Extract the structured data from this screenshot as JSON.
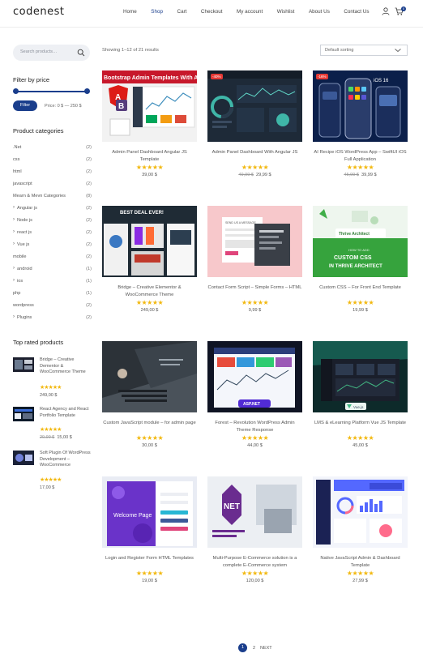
{
  "header": {
    "logo": "codenest",
    "nav": [
      "Home",
      "Shop",
      "Cart",
      "Checkout",
      "My account",
      "Wishlist",
      "About Us",
      "Contact Us"
    ],
    "active_nav": "Shop",
    "cart_count": "0"
  },
  "sidebar": {
    "search_placeholder": "Search products…",
    "filter_title": "Filter by price",
    "filter_button": "Filter",
    "price_text": "Price: 0 $ — 250 $",
    "categories_title": "Product categories",
    "categories": [
      {
        "name": ".Net",
        "count": "(2)",
        "sub": false
      },
      {
        "name": "css",
        "count": "(2)",
        "sub": false
      },
      {
        "name": "html",
        "count": "(2)",
        "sub": false
      },
      {
        "name": "javascript",
        "count": "(2)",
        "sub": false
      },
      {
        "name": "Mearn & Mevn Categories",
        "count": "(8)",
        "sub": false
      },
      {
        "name": "Angular js",
        "count": "(2)",
        "sub": true
      },
      {
        "name": "Node js",
        "count": "(2)",
        "sub": true
      },
      {
        "name": "react js",
        "count": "(2)",
        "sub": true
      },
      {
        "name": "Vue js",
        "count": "(2)",
        "sub": true
      },
      {
        "name": "mobile",
        "count": "(2)",
        "sub": false
      },
      {
        "name": "android",
        "count": "(1)",
        "sub": true
      },
      {
        "name": "ios",
        "count": "(1)",
        "sub": true
      },
      {
        "name": "php",
        "count": "(1)",
        "sub": false
      },
      {
        "name": "wordpress",
        "count": "(2)",
        "sub": false
      },
      {
        "name": "Plugins",
        "count": "(2)",
        "sub": true
      }
    ],
    "top_rated_title": "Top rated products",
    "top_rated": [
      {
        "name": "Bridge – Creative Dementor & WooCommerce Theme",
        "old_price": "",
        "price": "249,00 $"
      },
      {
        "name": "React Agency and React Portfolio Template",
        "old_price": "29,99 $",
        "price": "15,00 $"
      },
      {
        "name": "Soft Plugin Of WordPress Development – WooCommerce",
        "old_price": "",
        "price": "17,00 $"
      }
    ]
  },
  "main": {
    "result_count": "Showing 1–12 of 21 results",
    "sort_value": "Default sorting",
    "products": [
      {
        "title": "Admin Panel Dashboard Angular JS Template",
        "old_price": "",
        "price": "39,00 $",
        "badge": "",
        "img": "angular",
        "img_text": "Bootstrap Admin Templates With Angular"
      },
      {
        "title": "Admin Panel Dashboard With Angular JS",
        "old_price": "49,99 $",
        "price": "29,99 $",
        "badge": "-40%",
        "img": "dark-dash",
        "img_text": ""
      },
      {
        "title": "AI Recipe iOS WordPress App – SwiftUI iOS Full Application",
        "old_price": "45,99 $",
        "price": "39,99 $",
        "badge": "-16%",
        "img": "ios",
        "img_text": "iOS 16"
      },
      {
        "title": "Bridge – Creative Elementor & WooCommerce Theme",
        "old_price": "",
        "price": "249,00 $",
        "badge": "",
        "img": "bridge",
        "img_text": "BEST DEAL EVER!"
      },
      {
        "title": "Contact Form Script – Simple Forms – HTML",
        "old_price": "",
        "price": "9,99 $",
        "badge": "",
        "img": "contact",
        "img_text": "SEND US A MESSAGE"
      },
      {
        "title": "Custom CSS – For Front End Template",
        "old_price": "",
        "price": "19,99 $",
        "badge": "",
        "img": "thrive",
        "img_text": "CUSTOM CSS IN THRIVE ARCHITECT"
      },
      {
        "title": "Custom JavaScript module – for admin page",
        "old_price": "",
        "price": "30,00 $",
        "badge": "",
        "img": "laptop",
        "img_text": ""
      },
      {
        "title": "Forest – Revolution WordPress Admin Theme Response",
        "old_price": "",
        "price": "44,00 $",
        "badge": "",
        "img": "aspnet",
        "img_text": "ASP.NET"
      },
      {
        "title": "LMS & eLearning Platform Vue JS Template",
        "old_price": "",
        "price": "45,00 $",
        "badge": "",
        "img": "vue",
        "img_text": "Vue.js"
      },
      {
        "title": "Login and Register Form HTML Templates",
        "old_price": "",
        "price": "19,00 $",
        "badge": "",
        "img": "login",
        "img_text": "Welcome Page"
      },
      {
        "title": "Multi-Purpose E-Commerce solution is a complete E-Commerce system",
        "old_price": "",
        "price": "120,00 $",
        "badge": "",
        "img": "net",
        "img_text": "NET"
      },
      {
        "title": "Native JavaScript Admin & Dashboard Template",
        "old_price": "",
        "price": "27,99 $",
        "badge": "",
        "img": "native",
        "img_text": ""
      }
    ]
  },
  "pagination": {
    "current": "1",
    "next_page": "2",
    "next": "NEXT"
  },
  "colors": {
    "accent": "#1a3e8c",
    "star": "#f2b80f",
    "sale": "#e53935"
  },
  "icons": [
    "user-icon",
    "cart-icon",
    "search-icon",
    "chevron-down-icon",
    "star-icon"
  ]
}
